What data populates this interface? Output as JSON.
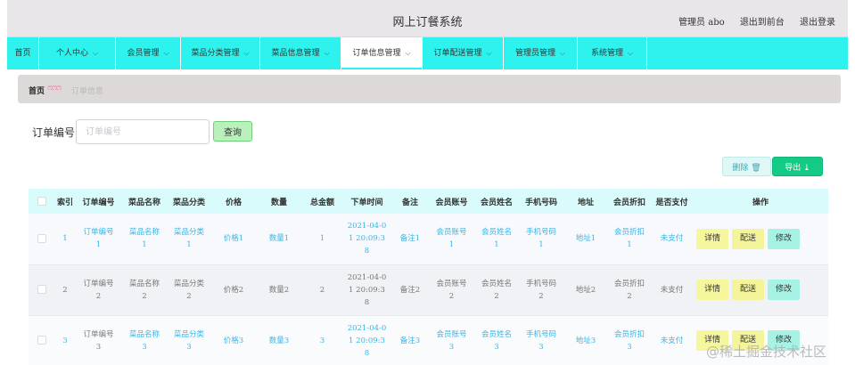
{
  "header": {
    "title": "网上订餐系统",
    "user_label": "管理员 abo",
    "back_to_front": "退出到前台",
    "logout": "退出登录"
  },
  "nav": {
    "items": [
      {
        "label": "首页",
        "dropdown": false
      },
      {
        "label": "个人中心",
        "dropdown": true
      },
      {
        "label": "会员管理",
        "dropdown": true
      },
      {
        "label": "菜品分类管理",
        "dropdown": true
      },
      {
        "label": "菜品信息管理",
        "dropdown": true
      },
      {
        "label": "订单信息管理",
        "dropdown": true,
        "active": true
      },
      {
        "label": "订单配送管理",
        "dropdown": true
      },
      {
        "label": "管理员管理",
        "dropdown": true
      },
      {
        "label": "系统管理",
        "dropdown": true
      }
    ],
    "chevron_icon": "chevron-down-icon",
    "background": "#2ef2ee"
  },
  "breadcrumb": {
    "home": "首页",
    "separator": "ෆෆෆ",
    "current": "订单信息"
  },
  "search": {
    "label": "订单编号",
    "placeholder": "订单编号",
    "value": "",
    "button": "查询"
  },
  "toolbar": {
    "delete_label": "删除 🗑",
    "export_label": "导出 ⤓",
    "delete_icon": "trash-icon",
    "export_icon": "download-icon"
  },
  "table": {
    "columns": [
      "",
      "索引",
      "订单编号",
      "菜品名称",
      "菜品分类",
      "价格",
      "数量",
      "总金额",
      "下单时间",
      "备注",
      "会员账号",
      "会员姓名",
      "手机号码",
      "地址",
      "会员折扣",
      "是否支付",
      "操作"
    ],
    "rows": [
      {
        "index": "1",
        "order_no": "订单编号\n1",
        "dish_name": "菜品名称\n1",
        "dish_category": "菜品分类\n1",
        "price": "价格1",
        "quantity": "数量1",
        "total": "1",
        "order_time": "2021-04-0\n1 20:09:3\n8",
        "remark": "备注1",
        "member_account": "会员账号\n1",
        "member_name": "会员姓名\n1",
        "phone": "手机号码\n1",
        "address": "地址1",
        "discount": "会员折扣\n1",
        "paid": "未支付"
      },
      {
        "index": "2",
        "order_no": "订单编号\n2",
        "dish_name": "菜品名称\n2",
        "dish_category": "菜品分类\n2",
        "price": "价格2",
        "quantity": "数量2",
        "total": "2",
        "order_time": "2021-04-0\n1 20:09:3\n8",
        "remark": "备注2",
        "member_account": "会员账号\n2",
        "member_name": "会员姓名\n2",
        "phone": "手机号码\n2",
        "address": "地址2",
        "discount": "会员折扣\n2",
        "paid": "未支付"
      },
      {
        "index": "3",
        "order_no": "订单编号\n3",
        "dish_name": "菜品名称\n3",
        "dish_category": "菜品分类\n3",
        "price": "价格3",
        "quantity": "数量3",
        "total": "3",
        "order_time": "2021-04-0\n1 20:09:3\n8",
        "remark": "备注3",
        "member_account": "会员账号\n3",
        "member_name": "会员姓名\n3",
        "phone": "手机号码\n3",
        "address": "地址3",
        "discount": "会员折扣\n3",
        "paid": "未支付"
      }
    ],
    "actions": {
      "detail": "详情",
      "ship": "配送",
      "edit": "修改"
    }
  },
  "watermark": "@稀土掘金技术社区"
}
